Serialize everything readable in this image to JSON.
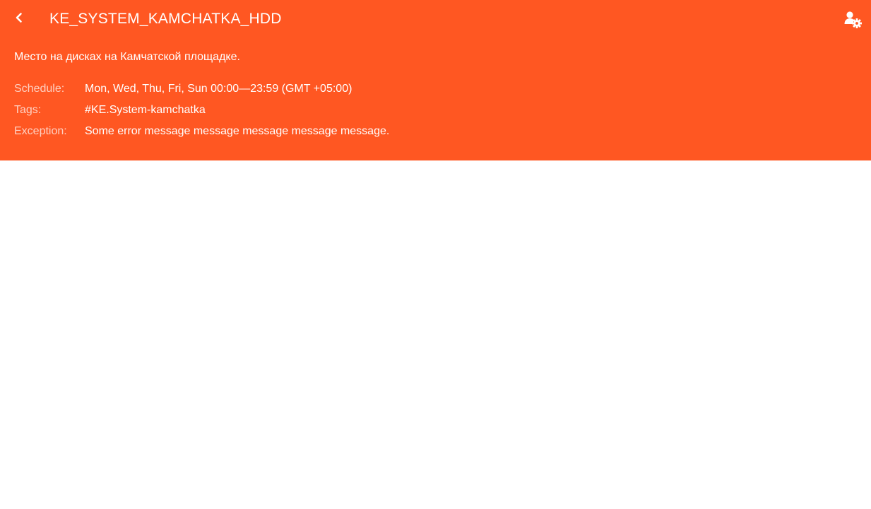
{
  "header": {
    "title": "KE_SYSTEM_KAMCHATKA_HDD",
    "back_icon": "chevron-left-icon",
    "settings_icon": "user-settings-icon",
    "background_color": "#ff5722",
    "text_color": "#ffffff"
  },
  "description": "Место на дисках на Камчатской площадке.",
  "details": {
    "schedule": {
      "label": "Schedule:",
      "value": "Mon, Wed, Thu, Fri, Sun 00:00—23:59 (GMT +05:00)"
    },
    "tags": {
      "label": "Tags:",
      "value": "#KE.System-kamchatka"
    },
    "exception": {
      "label": "Exception:",
      "value": "Some error message message message message message."
    }
  }
}
